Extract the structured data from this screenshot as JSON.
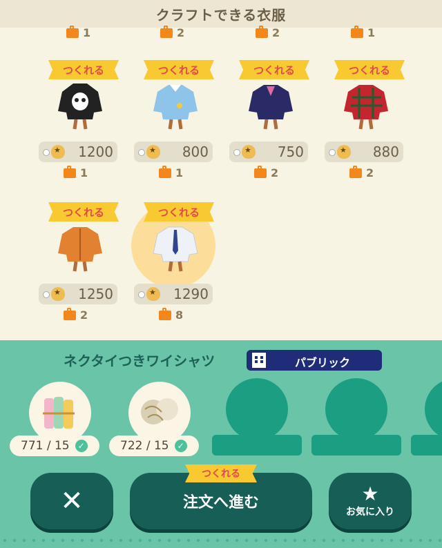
{
  "header": {
    "title": "クラフトできる衣服"
  },
  "top_counts": [
    "1",
    "2",
    "2",
    "1"
  ],
  "items": [
    {
      "tag": "つくれる",
      "price": "1200",
      "count": "1",
      "icon": "skull-hoodie-icon"
    },
    {
      "tag": "つくれる",
      "price": "800",
      "count": "1",
      "icon": "blue-smock-icon"
    },
    {
      "tag": "つくれる",
      "price": "750",
      "count": "2",
      "icon": "navy-uniform-icon"
    },
    {
      "tag": "つくれる",
      "price": "880",
      "count": "2",
      "icon": "tartan-jacket-icon"
    },
    {
      "tag": "つくれる",
      "price": "1250",
      "count": "2",
      "icon": "orange-jacket-icon"
    },
    {
      "tag": "つくれる",
      "price": "1290",
      "count": "8",
      "icon": "tie-shirt-icon"
    }
  ],
  "detail": {
    "title": "ネクタイつきワイシャツ",
    "visibility": "パブリック",
    "materials": [
      {
        "count": "771 / 15",
        "icon": "fabric-rolls-icon"
      },
      {
        "count": "722 / 15",
        "icon": "wool-yarn-icon"
      }
    ]
  },
  "buttons": {
    "close": "✕",
    "order_tag": "つくれる",
    "order": "注文へ進む",
    "favorite_icon": "★",
    "favorite": "お気に入り"
  },
  "colors": {
    "accent": "#6ac5a8",
    "tag": "#f9c932",
    "dark_button": "#165e56"
  }
}
